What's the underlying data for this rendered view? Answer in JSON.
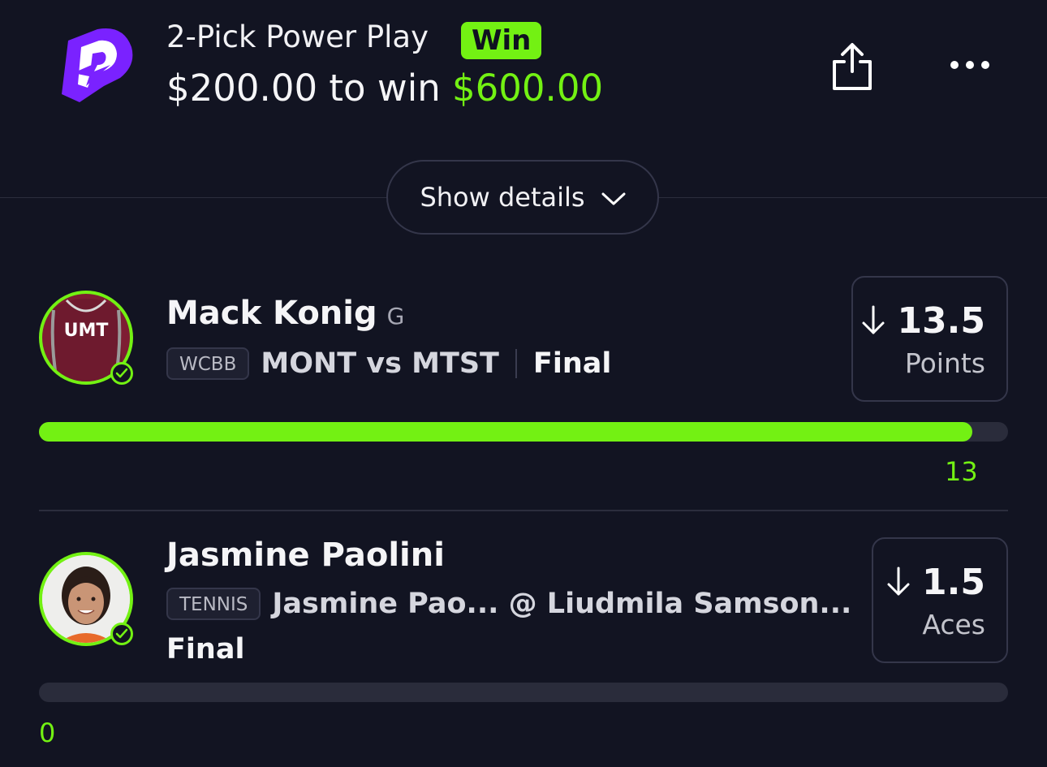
{
  "header": {
    "title": "2-Pick Power Play",
    "result_badge": "Win",
    "stake": "$200.00",
    "to_win_text": "to win",
    "payout": "$600.00"
  },
  "details_button": {
    "label": "Show details"
  },
  "picks": [
    {
      "player": "Mack Konig",
      "position": "G",
      "avatar_text": "UMT",
      "league": "WCBB",
      "matchup": "MONT vs MTST",
      "status": "Final",
      "direction": "down",
      "line": "13.5",
      "stat": "Points",
      "actual": "13",
      "progress": 0.963
    },
    {
      "player": "Jasmine Paolini",
      "position": "",
      "league": "TENNIS",
      "matchup": "Jasmine Pao... @ Liudmila Samson...",
      "status": "Final",
      "direction": "down",
      "line": "1.5",
      "stat": "Aces",
      "actual": "0",
      "progress": 0
    }
  ],
  "colors": {
    "accent": "#73f113",
    "background": "#121422",
    "brand_purple": "#7a22ff"
  }
}
